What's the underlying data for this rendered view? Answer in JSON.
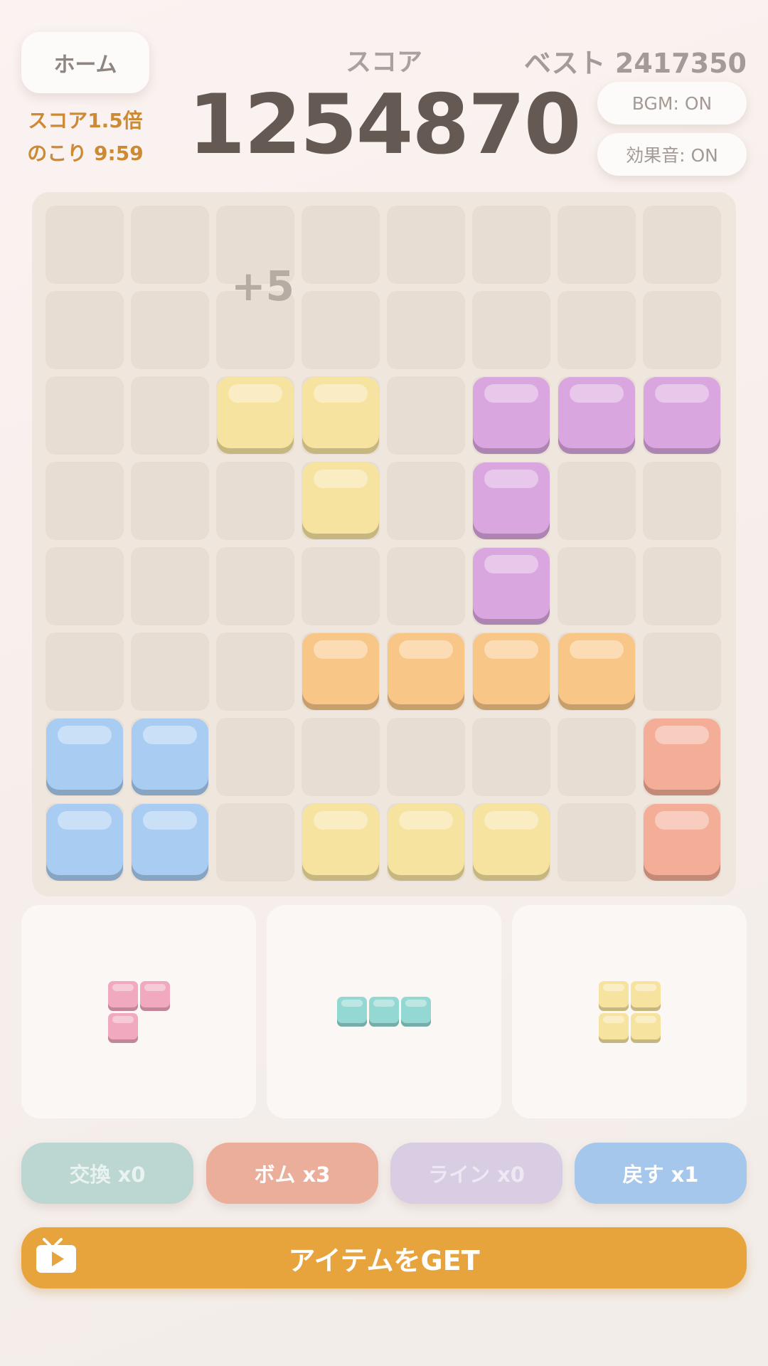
{
  "header": {
    "home_label": "ホーム",
    "bonus_multiplier": "スコア1.5倍",
    "bonus_time": "のこり 9:59",
    "score_label": "スコア",
    "score_value": "1254870",
    "best": "ベスト 2417350",
    "bgm_toggle": "BGM: ON",
    "sfx_toggle": "効果音: ON"
  },
  "colors": {
    "yellow": "#f7e3a0",
    "purple": "#d9a6df",
    "orange": "#f8c787",
    "blue": "#a9cdf2",
    "salmon": "#f4ad96",
    "pink": "#f1a9bf",
    "teal": "#93d8d2"
  },
  "board": {
    "size": 8,
    "floating_score": "+5",
    "filled": [
      {
        "row": 2,
        "col": 2,
        "color": "yellow"
      },
      {
        "row": 2,
        "col": 3,
        "color": "yellow"
      },
      {
        "row": 3,
        "col": 3,
        "color": "yellow"
      },
      {
        "row": 2,
        "col": 5,
        "color": "purple"
      },
      {
        "row": 2,
        "col": 6,
        "color": "purple"
      },
      {
        "row": 2,
        "col": 7,
        "color": "purple"
      },
      {
        "row": 3,
        "col": 5,
        "color": "purple"
      },
      {
        "row": 4,
        "col": 5,
        "color": "purple"
      },
      {
        "row": 5,
        "col": 3,
        "color": "orange"
      },
      {
        "row": 5,
        "col": 4,
        "color": "orange"
      },
      {
        "row": 5,
        "col": 5,
        "color": "orange"
      },
      {
        "row": 5,
        "col": 6,
        "color": "orange"
      },
      {
        "row": 6,
        "col": 0,
        "color": "blue"
      },
      {
        "row": 6,
        "col": 1,
        "color": "blue"
      },
      {
        "row": 7,
        "col": 0,
        "color": "blue"
      },
      {
        "row": 7,
        "col": 1,
        "color": "blue"
      },
      {
        "row": 6,
        "col": 7,
        "color": "salmon"
      },
      {
        "row": 7,
        "col": 7,
        "color": "salmon"
      },
      {
        "row": 7,
        "col": 3,
        "color": "yellow"
      },
      {
        "row": 7,
        "col": 4,
        "color": "yellow"
      },
      {
        "row": 7,
        "col": 5,
        "color": "yellow"
      }
    ]
  },
  "pieces": [
    {
      "name": "piece-1",
      "color": "pink",
      "cells": [
        [
          0,
          0
        ],
        [
          0,
          1
        ],
        [
          1,
          0
        ]
      ]
    },
    {
      "name": "piece-2",
      "color": "teal",
      "cells": [
        [
          0,
          0
        ],
        [
          0,
          1
        ],
        [
          0,
          2
        ]
      ]
    },
    {
      "name": "piece-3",
      "color": "yellow",
      "cells": [
        [
          0,
          0
        ],
        [
          0,
          1
        ],
        [
          1,
          0
        ],
        [
          1,
          1
        ]
      ]
    }
  ],
  "items": [
    {
      "name": "swap-button",
      "label": "交換 x0",
      "bg": "#bcd6d1",
      "fg": "#e8f2f0"
    },
    {
      "name": "bomb-button",
      "label": "ボム x3",
      "bg": "#eaae9b",
      "fg": "#ffffff"
    },
    {
      "name": "line-button",
      "label": "ライン x0",
      "bg": "#d8cde2",
      "fg": "#eee8f3"
    },
    {
      "name": "undo-button",
      "label": "戻す x1",
      "bg": "#a4c7eb",
      "fg": "#ffffff"
    }
  ],
  "get_button": {
    "label": "アイテムをGET",
    "icon": "tv-play-icon"
  }
}
